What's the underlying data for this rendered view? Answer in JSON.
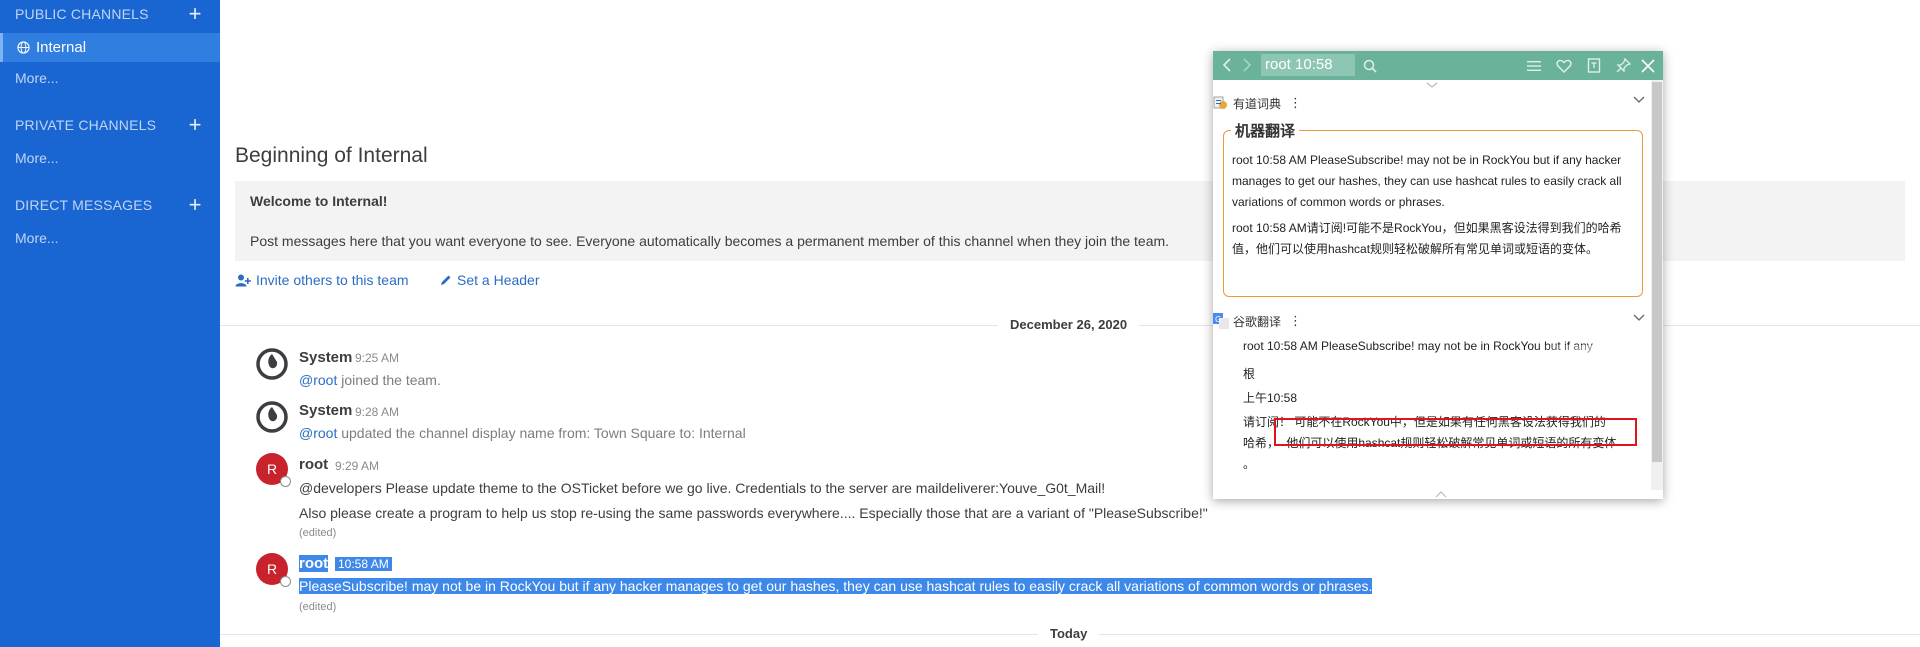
{
  "sidebar": {
    "public_header": "PUBLIC CHANNELS",
    "active_channel": "Internal",
    "public_more": "More...",
    "private_header": "PRIVATE CHANNELS",
    "private_more": "More...",
    "direct_header": "DIRECT MESSAGES",
    "direct_more": "More...",
    "plus": "+"
  },
  "intro": {
    "title": "Beginning of Internal",
    "welcome_title": "Welcome to Internal!",
    "welcome_text": "Post messages here that you want everyone to see. Everyone automatically becomes a permanent member of this channel when they join the team.",
    "invite_label": "Invite others to this team",
    "header_label": "Set a Header"
  },
  "date_separators": {
    "first": "December 26, 2020",
    "second": "Today"
  },
  "posts": [
    {
      "name": "System",
      "time": "9:25 AM",
      "mention": "@root",
      "text": " joined the team."
    },
    {
      "name": "System",
      "time": "9:28 AM",
      "mention": "@root",
      "text": " updated the channel display name from: Town Square to: Internal"
    },
    {
      "name": "root",
      "avatar": "R",
      "time": "9:29 AM",
      "line1": "@developers Please update theme to the OSTicket before we go live.  Credentials to the server are maildeliverer:Youve_G0t_Mail!",
      "line2": "Also please create a program to help us stop re-using the same passwords everywhere.... Especially those that are a variant of \"PleaseSubscribe!\"",
      "edited": "(edited)"
    },
    {
      "name": "root",
      "avatar": "R",
      "time": "10:58 AM",
      "line1": "PleaseSubscribe! may not be in RockYou but if any hacker manages to get our hashes, they can use hashcat rules to easily crack all variations of common words or phrases.",
      "edited": "(edited)"
    }
  ],
  "popup": {
    "query": "root 10:58",
    "youdao_name": "有道词典",
    "menu_dots": "⋮",
    "mt_title": "机器翻译",
    "mt_source": "root 10:58 AM PleaseSubscribe! may not be in RockYou but if any hacker manages to get our hashes, they can use hashcat rules to easily crack all variations of common words or phrases.",
    "mt_translation": "root 10:58 AM请订阅!可能不是RockYou，但如果黑客设法得到我们的哈希值，他们可以使用hashcat规则轻松破解所有常见单词或短语的变体。",
    "google_name": "谷歌翻译",
    "g_source": "root 10:58 AM PleaseSubscribe! may not be in RockYou but if any",
    "g_line1": "根",
    "g_line2": "上午10:58",
    "g_line3": "请订阅！ 可能不在RockYou中，但是如果有任何黑客设法获得我们的",
    "g_line4a": "哈希，",
    "g_line4b": "他们可以使用hashcat规则轻松破解常见单词或短语的所有变体",
    "g_line5": "。"
  },
  "colors": {
    "sidebar_bg": "#1966d2",
    "popup_bar": "#6ab29a",
    "mt_border": "#e89a3c",
    "highlight_box": "#e0151c",
    "selection": "#3d88e8",
    "link": "#2b6dc4",
    "avatar_red": "#c8232c"
  },
  "icons": [
    "globe-icon",
    "plus-icon",
    "invite-icon",
    "pencil-icon",
    "back-icon",
    "forward-icon",
    "search-icon",
    "menu-icon",
    "heart-icon",
    "book-icon",
    "pin-icon",
    "close-icon",
    "chevron-down-icon",
    "youdao-logo-icon",
    "google-translate-icon",
    "mattermost-logo-icon"
  ]
}
